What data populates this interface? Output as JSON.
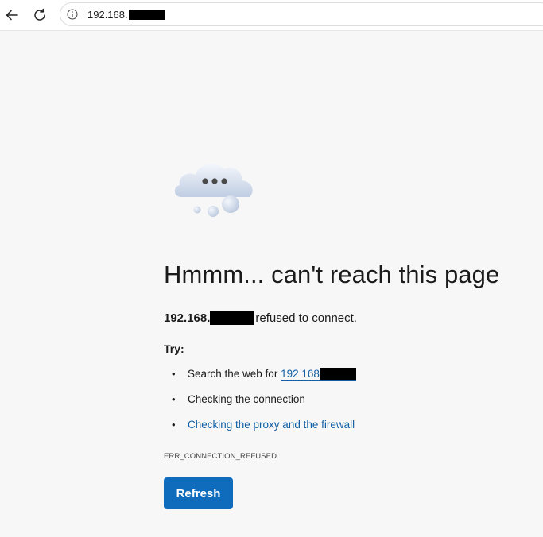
{
  "browser": {
    "url": "192.168.",
    "back_icon": "arrow-left-icon",
    "refresh_icon": "reload-icon",
    "site_info_icon": "info-icon"
  },
  "error_page": {
    "illustration": "cloud-icon",
    "heading": "Hmmm... can't reach this page",
    "host": "192.168.",
    "refused_text": "refused to connect.",
    "try_label": "Try:",
    "suggestions": {
      "search_prefix": "Search the web for ",
      "search_link": "192 168",
      "check_connection": "Checking the connection",
      "check_proxy": "Checking the proxy and the firewall"
    },
    "error_code": "ERR_CONNECTION_REFUSED",
    "refresh_label": "Refresh"
  },
  "colors": {
    "background": "#f7f7f7",
    "link": "#115ea3",
    "button": "#0f6cbd",
    "redaction": "#000000"
  }
}
